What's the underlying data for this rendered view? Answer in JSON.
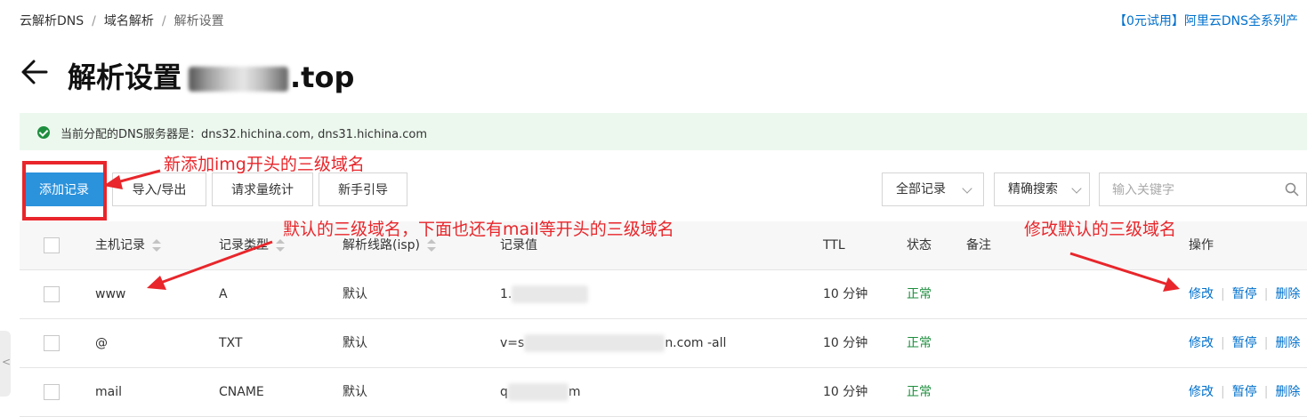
{
  "breadcrumb": {
    "items": [
      "云解析DNS",
      "域名解析",
      "解析设置"
    ],
    "sep": "/"
  },
  "promo": "【0元试用】阿里云DNS全系列产",
  "title": {
    "text": "解析设置",
    "domain_tail": ".top"
  },
  "banner": {
    "text": "当前分配的DNS服务器是：dns32.hichina.com, dns31.hichina.com"
  },
  "toolbar": {
    "add": "添加记录",
    "import_export": "导入/导出",
    "stats": "请求量统计",
    "guide": "新手引导",
    "filter_select": "全部记录",
    "search_mode": "精确搜索",
    "search_placeholder": "输入关键字"
  },
  "table": {
    "headers": {
      "host": "主机记录",
      "type": "记录类型",
      "line": "解析线路(isp)",
      "value": "记录值",
      "ttl": "TTL",
      "status": "状态",
      "remark": "备注",
      "ops": "操作"
    },
    "rows": [
      {
        "host": "www",
        "type": "A",
        "line": "默认",
        "value_prefix": "1.",
        "value_suffix": "",
        "ttl": "10 分钟",
        "status": "正常"
      },
      {
        "host": "@",
        "type": "TXT",
        "line": "默认",
        "value_prefix": "v=s",
        "value_suffix": "n.com -all",
        "ttl": "10 分钟",
        "status": "正常"
      },
      {
        "host": "mail",
        "type": "CNAME",
        "line": "默认",
        "value_prefix": "q",
        "value_suffix": "m",
        "ttl": "10 分钟",
        "status": "正常"
      }
    ],
    "actions": {
      "edit": "修改",
      "pause": "暂停",
      "delete": "删除"
    }
  },
  "annotations": {
    "add": "新添加img开头的三级域名",
    "default": "默认的三级域名，下面也还有mail等开头的三级域名",
    "edit": "修改默认的三级域名"
  },
  "side_tab": "<",
  "colors": {
    "primary": "#2b92dc",
    "link": "#0070cc",
    "success": "#1e8e3e",
    "annotation": "#e8262b",
    "banner_bg": "#ecf8ee"
  }
}
